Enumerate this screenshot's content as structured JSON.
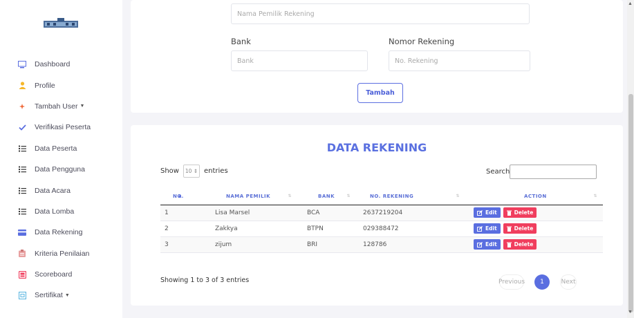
{
  "sidebar": {
    "items": [
      {
        "label": "Dashboard",
        "icon": "monitor-icon",
        "color": "#5a6ee0"
      },
      {
        "label": "Profile",
        "icon": "user-icon",
        "color": "#f6b72a"
      },
      {
        "label": "Tambah User",
        "icon": "sparkle-icon",
        "color": "#f06a3a",
        "caret": true
      },
      {
        "label": "Verifikasi Peserta",
        "icon": "check-icon",
        "color": "#5a6ee0"
      },
      {
        "label": "Data Peserta",
        "icon": "list-icon",
        "color": "#333"
      },
      {
        "label": "Data Pengguna",
        "icon": "list-icon",
        "color": "#333"
      },
      {
        "label": "Data Acara",
        "icon": "list-icon",
        "color": "#333"
      },
      {
        "label": "Data Lomba",
        "icon": "list-icon",
        "color": "#333"
      },
      {
        "label": "Data Rekening",
        "icon": "credit-card-icon",
        "color": "#5a6ee0"
      },
      {
        "label": "Kriteria Penilaian",
        "icon": "clipboard-icon",
        "color": "#e8a0a0"
      },
      {
        "label": "Scoreboard",
        "icon": "scoreboard-icon",
        "color": "#f03e5e"
      },
      {
        "label": "Sertifikat",
        "icon": "certificate-icon",
        "color": "#5ab5e0",
        "caret": true
      }
    ]
  },
  "form": {
    "nama_placeholder": "Nama Pemilik Rekening",
    "bank_label": "Bank",
    "bank_placeholder": "Bank",
    "rek_label": "Nomor Rekening",
    "rek_placeholder": "No. Rekening",
    "submit_label": "Tambah"
  },
  "table_section": {
    "title": "DATA REKENING",
    "show_label": "Show",
    "length_value": "10",
    "entries_label": "entries",
    "search_label": "Search:",
    "headers": [
      "NO.",
      "NAMA PEMILIK",
      "BANK",
      "NO. REKENING",
      "ACTION"
    ],
    "rows": [
      {
        "no": "1",
        "nama": "Lisa Marsel",
        "bank": "BCA",
        "rek": "2637219204"
      },
      {
        "no": "2",
        "nama": "Zakkya",
        "bank": "BTPN",
        "rek": "029388472"
      },
      {
        "no": "3",
        "nama": "zijum",
        "bank": "BRI",
        "rek": "128786"
      }
    ],
    "edit_label": "Edit",
    "delete_label": "Delete",
    "info": "Showing 1 to 3 of 3 entries",
    "prev_label": "Previous",
    "current_page": "1",
    "next_label": "Next"
  },
  "colors": {
    "accent": "#5a6ee0",
    "danger": "#f03e5e"
  }
}
